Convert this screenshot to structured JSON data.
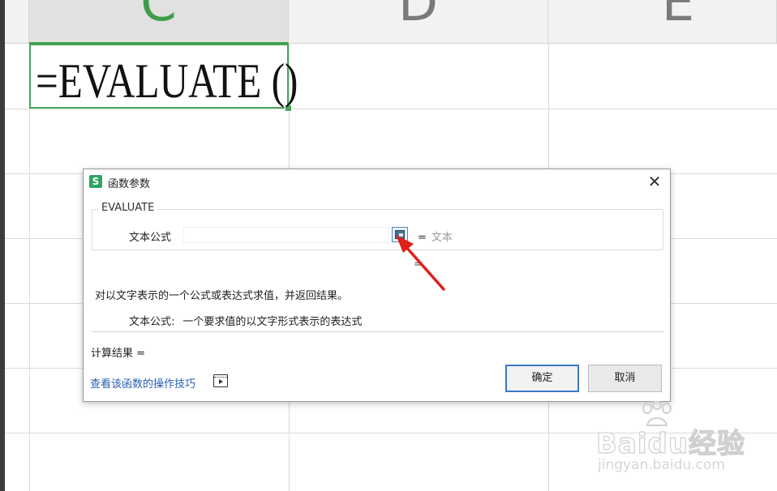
{
  "spreadsheet": {
    "columns": [
      "C",
      "D",
      "E"
    ],
    "selected_column": "C",
    "active_cell_formula": "=EVALUATE ()"
  },
  "dialog": {
    "icon_label": "S",
    "title": "函数参数",
    "close_glyph": "✕",
    "function_name": "EVALUATE",
    "argument_label": "文本公式",
    "argument_value": "",
    "argument_result_eq": "=",
    "argument_result": "文本",
    "formula_eq": "=",
    "description": "对以文字表示的一个公式或表达式求值，并返回结果。",
    "argument_desc_label": "文本公式:",
    "argument_desc_text": "一个要求值的以文字形式表示的表达式",
    "calc_result_label": "计算结果 =",
    "calc_result_value": "",
    "help_link": "查看该函数的操作技巧",
    "ok_button": "确定",
    "cancel_button": "取消"
  },
  "annotation": {
    "arrow_color": "#e0201b",
    "target": "ref-select-button"
  },
  "watermark": {
    "brand": "Baidu经验",
    "url": "jingyan.baidu.com"
  },
  "colors": {
    "accent_green": "#4aa55a",
    "link_blue": "#2a5eb3",
    "ok_border": "#3a78c9"
  }
}
